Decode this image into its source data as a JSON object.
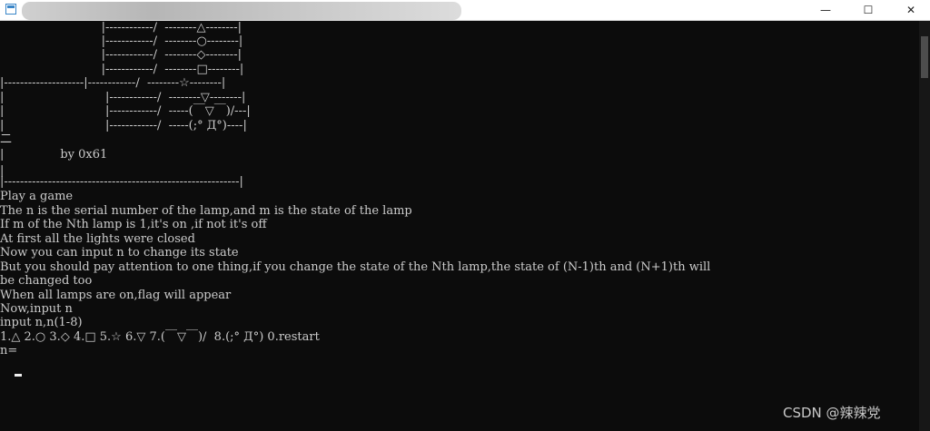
{
  "window": {
    "minimize_glyph": "—",
    "maximize_glyph": "☐",
    "close_glyph": "✕"
  },
  "console": {
    "banner": [
      "                           |------------/  --------△--------|",
      "                           |------------/  --------○--------|",
      "                           |------------/  --------◇--------|",
      "                           |------------/  --------□--------|",
      "|--------------------|------------/  --------☆--------|",
      "|                           |------------/  --------▽--------|",
      "|                           |------------/  -----(￣▽￣)/---|",
      "|                           |------------/  -----(;° Д°)----|",
      "二",
      "|               by 0x61",
      "|",
      "|-----------------------------------------------------------|"
    ],
    "lines": [
      "Play a game",
      "The n is the serial number of the lamp,and m is the state of the lamp",
      "If m of the Nth lamp is 1,it's on ,if not it's off",
      "At first all the lights were closed",
      "Now you can input n to change its state",
      "But you should pay attention to one thing,if you change the state of the Nth lamp,the state of (N-1)th and (N+1)th will",
      "be changed too",
      "When all lamps are on,flag will appear",
      "Now,input n",
      "input n,n(1-8)",
      "1.△ 2.○ 3.◇ 4.□ 5.☆ 6.▽ 7.(￣▽￣)/  8.(;° Д°) 0.restart",
      "n="
    ]
  },
  "watermark": "CSDN @辣辣党"
}
